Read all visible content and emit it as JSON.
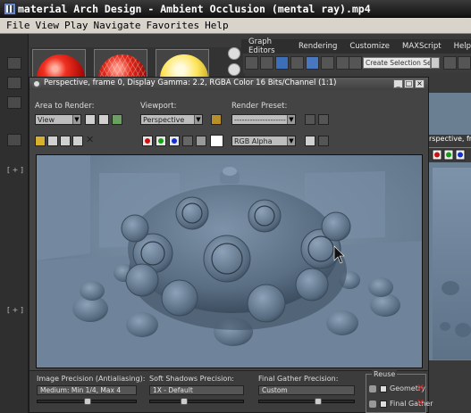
{
  "player": {
    "title": "material Arch Design - Ambient Occlusion (mental ray).mp4",
    "menu": [
      "File",
      "View",
      "Play",
      "Navigate",
      "Favorites",
      "Help"
    ]
  },
  "max": {
    "menu": [
      "Graph Editors",
      "Rendering",
      "Customize",
      "MAXScript",
      "Help"
    ],
    "selection_set_placeholder": "Create Selection Se",
    "background_viewport_title": "rspective, frame",
    "left_labels": [
      "[ + ]"
    ]
  },
  "render_window": {
    "title": "Perspective, frame 0, Display Gamma: 2.2, RGBA Color 16 Bits/Channel (1:1)",
    "area_to_render_label": "Area to Render:",
    "area_to_render_value": "View",
    "viewport_label": "Viewport:",
    "viewport_value": "Perspective",
    "render_preset_label": "Render Preset:",
    "render_preset_value": "--------------------",
    "channel_value": "RGB Alpha",
    "channel_colors": {
      "red": "#d01010",
      "green": "#10a010",
      "blue": "#1030d0"
    }
  },
  "bottom_panel": {
    "image_precision_label": "Image Precision (Antialiasing):",
    "image_precision_value": "Medium: Min 1/4, Max 4",
    "soft_shadows_label": "Soft Shadows Precision:",
    "soft_shadows_value": "1X - Default",
    "final_gather_label": "Final Gather Precision:",
    "final_gather_value": "Custom",
    "reuse_label": "Reuse",
    "reuse_geometry": "Geometry",
    "reuse_final_gather": "Final Gather"
  },
  "colors": {
    "render_background": "#6e839a",
    "object": "#5f7387"
  }
}
